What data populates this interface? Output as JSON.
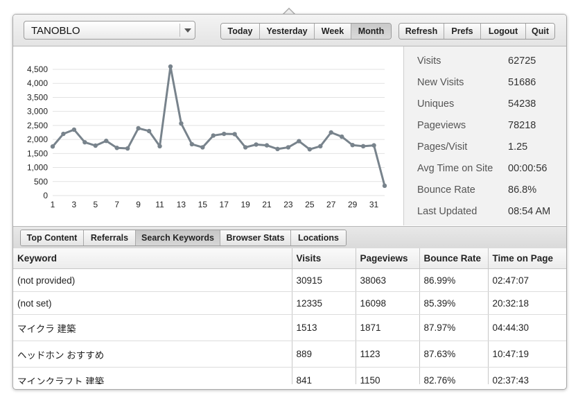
{
  "site_selector": {
    "value": "TANOBLO"
  },
  "period_buttons": [
    "Today",
    "Yesterday",
    "Week",
    "Month"
  ],
  "active_period": "Month",
  "action_buttons": [
    "Refresh",
    "Prefs",
    "Logout",
    "Quit"
  ],
  "stats": [
    {
      "label": "Visits",
      "value": "62725"
    },
    {
      "label": "New Visits",
      "value": "51686"
    },
    {
      "label": "Uniques",
      "value": "54238"
    },
    {
      "label": "Pageviews",
      "value": "78218"
    },
    {
      "label": "Pages/Visit",
      "value": "1.25"
    },
    {
      "label": "Avg Time on Site",
      "value": "00:00:56"
    },
    {
      "label": "Bounce Rate",
      "value": "86.8%"
    },
    {
      "label": "Last Updated",
      "value": "08:54 AM"
    }
  ],
  "tabs": [
    "Top Content",
    "Referrals",
    "Search Keywords",
    "Browser Stats",
    "Locations"
  ],
  "active_tab": "Search Keywords",
  "table": {
    "headers": [
      "Keyword",
      "Visits",
      "Pageviews",
      "Bounce Rate",
      "Time on Page"
    ],
    "rows": [
      [
        "(not provided)",
        "30915",
        "38063",
        "86.99%",
        "02:47:07"
      ],
      [
        "(not set)",
        "12335",
        "16098",
        "85.39%",
        "20:32:18"
      ],
      [
        "マイクラ 建築",
        "1513",
        "1871",
        "87.97%",
        "04:44:30"
      ],
      [
        "ヘッドホン おすすめ",
        "889",
        "1123",
        "87.63%",
        "10:47:19"
      ],
      [
        "マインクラフト 建築",
        "841",
        "1150",
        "82.76%",
        "02:37:43"
      ]
    ]
  },
  "colors": {
    "line": "#78838c",
    "grid": "#e2e2e2"
  },
  "chart_data": {
    "type": "line",
    "x": [
      1,
      2,
      3,
      4,
      5,
      6,
      7,
      8,
      9,
      10,
      11,
      12,
      13,
      14,
      15,
      16,
      17,
      18,
      19,
      20,
      21,
      22,
      23,
      24,
      25,
      26,
      27,
      28,
      29,
      30,
      31,
      32
    ],
    "x_ticks": [
      "1",
      "3",
      "5",
      "7",
      "9",
      "11",
      "13",
      "15",
      "17",
      "19",
      "21",
      "23",
      "25",
      "27",
      "29",
      "31"
    ],
    "y_ticks": [
      "0",
      "500",
      "1,000",
      "1,500",
      "2,000",
      "2,500",
      "3,000",
      "3,500",
      "4,000",
      "4,500"
    ],
    "ylim": [
      0,
      4500
    ],
    "grid": true,
    "series": [
      {
        "values": [
          1750,
          2200,
          2350,
          1900,
          1780,
          1950,
          1700,
          1680,
          2400,
          2300,
          1760,
          4600,
          2570,
          1830,
          1720,
          2140,
          2200,
          2190,
          1720,
          1820,
          1790,
          1660,
          1720,
          1940,
          1650,
          1760,
          2250,
          2100,
          1800,
          1760,
          1790,
          350
        ]
      }
    ]
  }
}
